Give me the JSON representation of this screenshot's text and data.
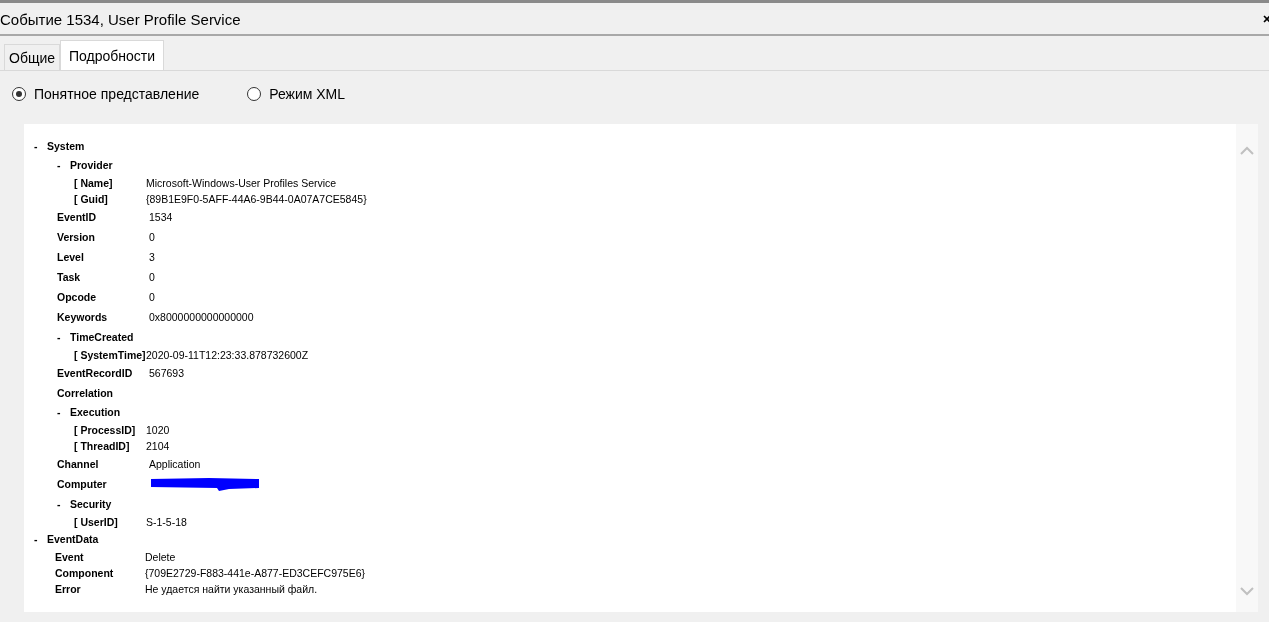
{
  "window": {
    "title": "Событие 1534, User Profile Service"
  },
  "tabs": [
    {
      "label": "Общие",
      "selected": false
    },
    {
      "label": "Подробности",
      "selected": true
    }
  ],
  "view_modes": [
    {
      "label": "Понятное представление",
      "selected": true
    },
    {
      "label": "Режим XML",
      "selected": false
    }
  ],
  "tree": [
    {
      "kind": "section",
      "toggle": "-",
      "label": "System",
      "children": [
        {
          "kind": "section",
          "toggle": "-",
          "label": "Provider",
          "children": [
            {
              "kind": "attribute",
              "label": "[ Name]",
              "value": "Microsoft-Windows-User Profiles Service"
            },
            {
              "kind": "attribute",
              "label": "[ Guid]",
              "value": "{89B1E9F0-5AFF-44A6-9B44-0A07A7CE5845}"
            }
          ]
        },
        {
          "kind": "field",
          "label": "EventID",
          "value": "1534"
        },
        {
          "kind": "field",
          "label": "Version",
          "value": "0"
        },
        {
          "kind": "field",
          "label": "Level",
          "value": "3"
        },
        {
          "kind": "field",
          "label": "Task",
          "value": "0"
        },
        {
          "kind": "field",
          "label": "Opcode",
          "value": "0"
        },
        {
          "kind": "field",
          "label": "Keywords",
          "value": "0x8000000000000000"
        },
        {
          "kind": "section",
          "toggle": "-",
          "label": "TimeCreated",
          "children": [
            {
              "kind": "attribute",
              "label": "[ SystemTime]",
              "value": "2020-09-11T12:23:33.878732600Z"
            }
          ]
        },
        {
          "kind": "field",
          "label": "EventRecordID",
          "value": "567693"
        },
        {
          "kind": "field",
          "label": "Correlation"
        },
        {
          "kind": "section",
          "toggle": "-",
          "label": "Execution",
          "children": [
            {
              "kind": "attribute",
              "label": "[ ProcessID]",
              "value": "1020"
            },
            {
              "kind": "attribute",
              "label": "[ ThreadID]",
              "value": "2104"
            }
          ]
        },
        {
          "kind": "field",
          "label": "Channel",
          "value": "Application"
        },
        {
          "kind": "field",
          "label": "Computer",
          "redacted": true
        },
        {
          "kind": "section",
          "toggle": "-",
          "label": "Security",
          "children": [
            {
              "kind": "attribute",
              "label": "[ UserID]",
              "value": "S-1-5-18"
            }
          ]
        }
      ]
    },
    {
      "kind": "section",
      "toggle": "-",
      "label": "EventData",
      "children": [
        {
          "kind": "data",
          "label": "Event",
          "value": "Delete"
        },
        {
          "kind": "data",
          "label": "Component",
          "value": "{709E2729-F883-441e-A877-ED3CEFC975E6}"
        },
        {
          "kind": "data",
          "label": "Error",
          "value": "Не удается найти указанный файл."
        }
      ]
    }
  ]
}
